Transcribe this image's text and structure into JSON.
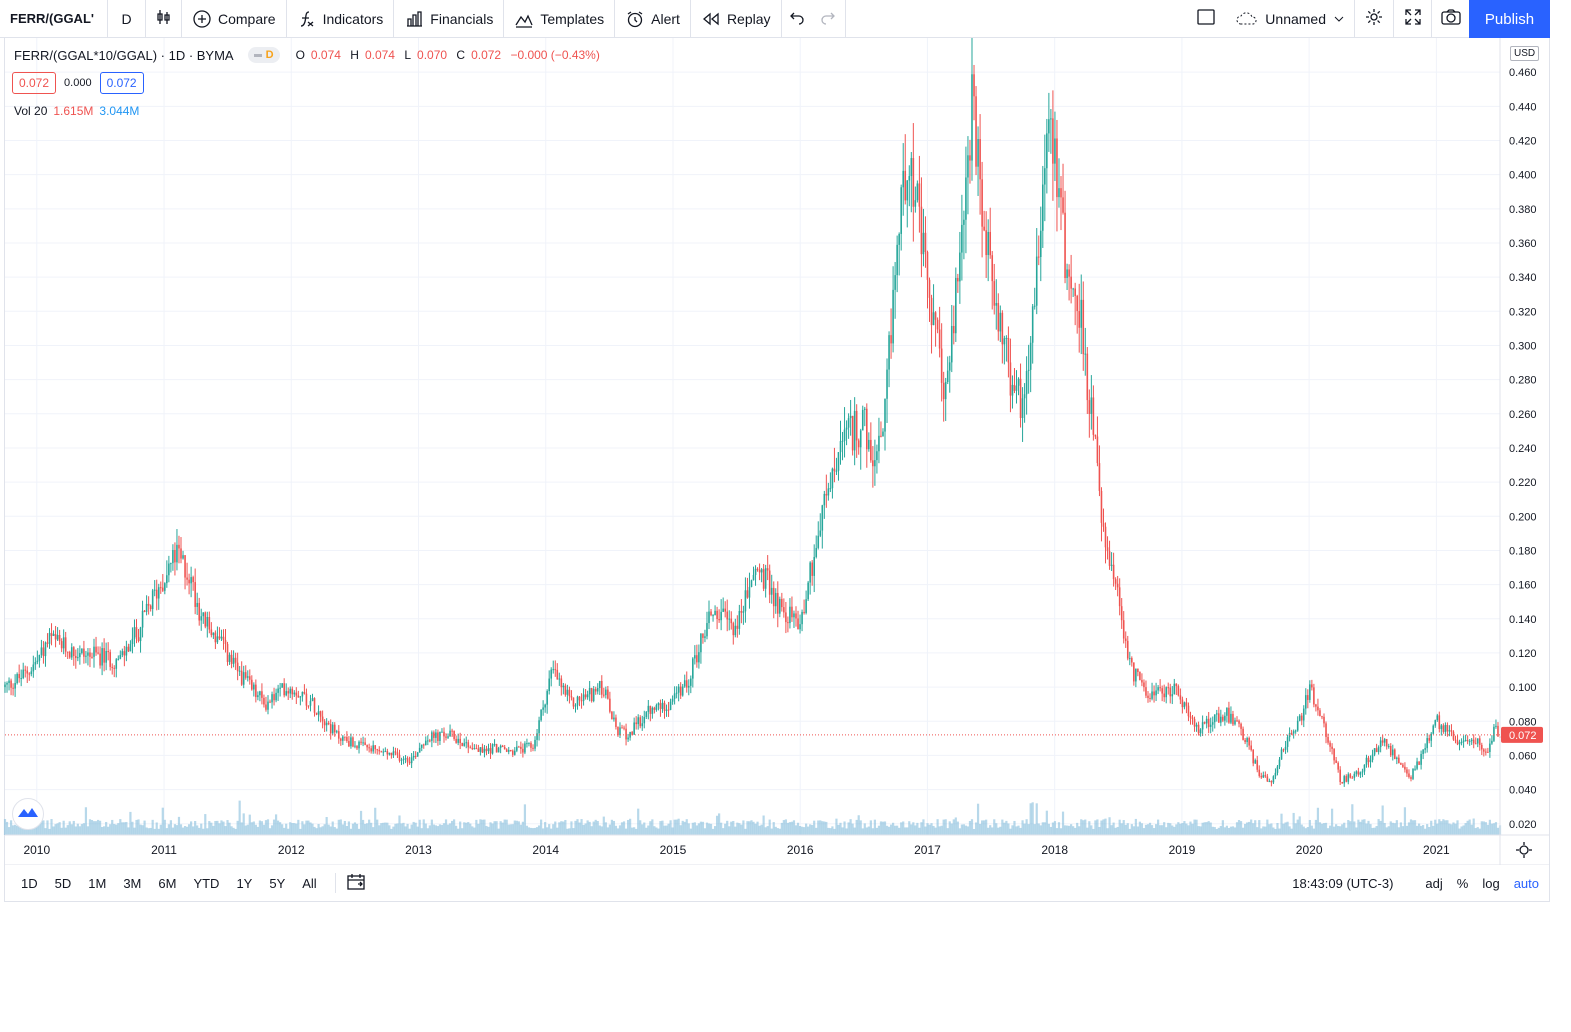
{
  "toolbar": {
    "symbol": "FERR/(GGAL'",
    "interval": "D",
    "compare": "Compare",
    "indicators": "Indicators",
    "financials": "Financials",
    "templates": "Templates",
    "alert": "Alert",
    "replay": "Replay",
    "layout_name": "Unnamed",
    "publish": "Publish"
  },
  "legend": {
    "title": "FERR/(GGAL*10/GGAL) · 1D · BYMA",
    "badge": "D",
    "ohlc": [
      {
        "key": "O",
        "value": "0.074"
      },
      {
        "key": "H",
        "value": "0.074"
      },
      {
        "key": "L",
        "value": "0.070"
      },
      {
        "key": "C",
        "value": "0.072"
      }
    ],
    "change": "−0.000 (−0.43%)",
    "sell_price": "0.072",
    "spread": "0.000",
    "buy_price": "0.072"
  },
  "volume_legend": {
    "label": "Vol 20",
    "value1": "1.615M",
    "value2": "3.044M"
  },
  "currency": "USD",
  "chart_data": {
    "type": "line",
    "title": "FERR/(GGAL*10/GGAL) · 1D · BYMA",
    "xlabel": "",
    "ylabel": "",
    "x_ticks": [
      "2010",
      "2011",
      "2012",
      "2013",
      "2014",
      "2015",
      "2016",
      "2017",
      "2018",
      "2019",
      "2020",
      "2021"
    ],
    "y_ticks": [
      "0.020",
      "0.040",
      "0.060",
      "0.080",
      "0.100",
      "0.120",
      "0.140",
      "0.160",
      "0.180",
      "0.200",
      "0.220",
      "0.240",
      "0.260",
      "0.280",
      "0.300",
      "0.320",
      "0.340",
      "0.360",
      "0.380",
      "0.400",
      "0.420",
      "0.440",
      "0.460"
    ],
    "ylim": [
      0.014,
      0.48
    ],
    "xlim": [
      2009.75,
      2021.5
    ],
    "last_price": 0.072,
    "last_price_label": "0.072",
    "up_color": "#26a69a",
    "down_color": "#ef5350",
    "volume_color": "#7cb8d8",
    "grid": true,
    "series": [
      {
        "values_x": [
          2009.75,
          2009.9,
          2010.0,
          2010.1,
          2010.3,
          2010.5,
          2010.65,
          2010.8,
          2010.9,
          2011.0,
          2011.1,
          2011.2,
          2011.3,
          2011.45,
          2011.55,
          2011.7,
          2011.8,
          2011.95,
          2012.05,
          2012.2,
          2012.35,
          2012.55,
          2012.8,
          2012.95,
          2013.05,
          2013.25,
          2013.5,
          2013.6,
          2013.7,
          2013.9,
          2014.05,
          2014.2,
          2014.45,
          2014.55,
          2014.65,
          2014.8,
          2014.95,
          2015.1,
          2015.3,
          2015.5,
          2015.65,
          2015.75,
          2015.85,
          2016.0,
          2016.1,
          2016.2,
          2016.35,
          2016.5,
          2016.55,
          2016.65,
          2016.75,
          2016.85,
          2016.95,
          2017.05,
          2017.15,
          2017.25,
          2017.35,
          2017.45,
          2017.55,
          2017.65,
          2017.75,
          2017.85,
          2017.95,
          2018.0,
          2018.1,
          2018.2,
          2018.3,
          2018.4,
          2018.5,
          2018.6,
          2018.7,
          2018.8,
          2018.95,
          2019.1,
          2019.2,
          2019.35,
          2019.5,
          2019.6,
          2019.7,
          2019.8,
          2019.95,
          2020.0,
          2020.15,
          2020.25,
          2020.4,
          2020.5,
          2020.6,
          2020.7,
          2020.8,
          2020.9,
          2021.0,
          2021.1,
          2021.2,
          2021.3,
          2021.4,
          2021.45,
          2021.5
        ],
        "values_y": [
          0.1,
          0.107,
          0.115,
          0.128,
          0.12,
          0.118,
          0.115,
          0.133,
          0.15,
          0.165,
          0.178,
          0.165,
          0.14,
          0.125,
          0.112,
          0.098,
          0.09,
          0.1,
          0.098,
          0.088,
          0.072,
          0.065,
          0.06,
          0.058,
          0.07,
          0.072,
          0.062,
          0.065,
          0.062,
          0.065,
          0.11,
          0.09,
          0.1,
          0.075,
          0.072,
          0.085,
          0.09,
          0.1,
          0.145,
          0.135,
          0.17,
          0.16,
          0.145,
          0.138,
          0.175,
          0.21,
          0.245,
          0.255,
          0.23,
          0.24,
          0.35,
          0.42,
          0.36,
          0.31,
          0.27,
          0.35,
          0.44,
          0.36,
          0.325,
          0.28,
          0.265,
          0.34,
          0.44,
          0.42,
          0.34,
          0.32,
          0.25,
          0.18,
          0.15,
          0.11,
          0.1,
          0.095,
          0.1,
          0.075,
          0.08,
          0.085,
          0.07,
          0.05,
          0.045,
          0.065,
          0.085,
          0.1,
          0.07,
          0.045,
          0.05,
          0.062,
          0.068,
          0.055,
          0.048,
          0.062,
          0.08,
          0.075,
          0.065,
          0.07,
          0.062,
          0.075,
          0.072
        ]
      }
    ]
  },
  "time_axis": {
    "clock": "18:43:09 (UTC-3)"
  },
  "ranges": [
    "1D",
    "5D",
    "1M",
    "3M",
    "6M",
    "YTD",
    "1Y",
    "5Y",
    "All"
  ],
  "bottom_options": {
    "adj": "adj",
    "percent": "%",
    "log": "log",
    "auto": "auto"
  }
}
